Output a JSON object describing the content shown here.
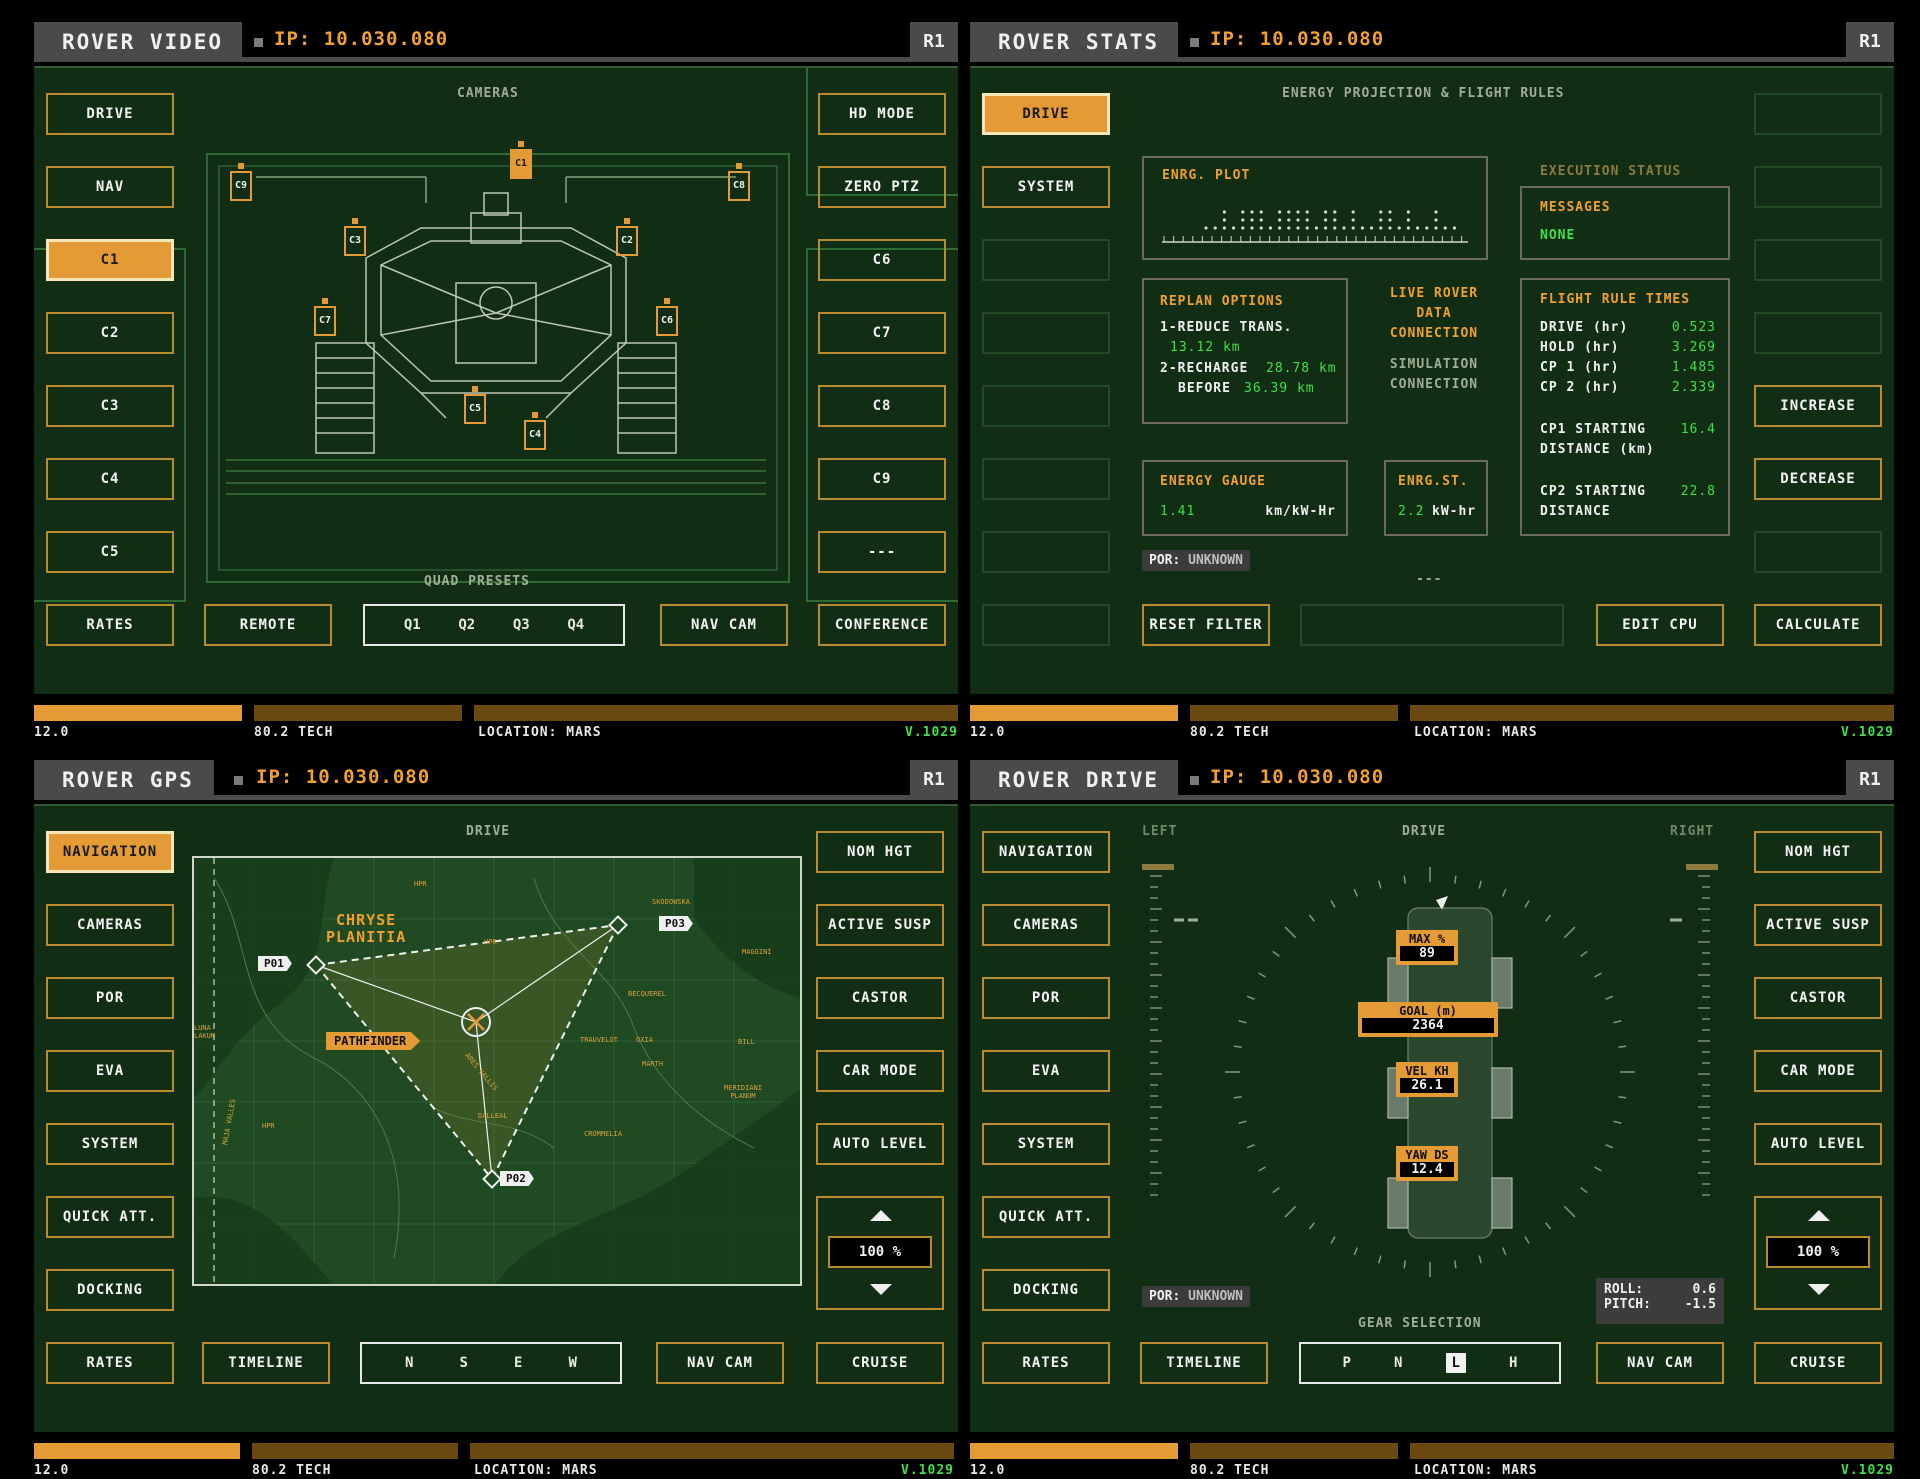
{
  "header": {
    "ip": "IP: 10.030.080",
    "rank": "R1"
  },
  "footer": {
    "value": "12.0",
    "tech": "80.2 TECH",
    "location": "LOCATION: MARS",
    "version": "V.1029"
  },
  "video": {
    "title": "ROVER VIDEO",
    "cameras_label": "CAMERAS",
    "quad_label": "QUAD PRESETS",
    "left": [
      "DRIVE",
      "NAV",
      "C1",
      "C2",
      "C3",
      "C4",
      "C5"
    ],
    "right": [
      "HD MODE",
      "ZERO PTZ",
      "C6",
      "C7",
      "C8",
      "C9",
      "---"
    ],
    "bottom": {
      "rates": "RATES",
      "remote": "REMOTE",
      "quads": [
        "Q1",
        "Q2",
        "Q3",
        "Q4"
      ],
      "navcam": "NAV CAM",
      "conference": "CONFERENCE"
    },
    "tags": [
      "C1",
      "C2",
      "C3",
      "C4",
      "C5",
      "C6",
      "C7",
      "C8",
      "C9"
    ]
  },
  "stats": {
    "title": "ROVER STATS",
    "left": [
      "DRIVE",
      "SYSTEM"
    ],
    "heading": "ENERGY PROJECTION & FLIGHT RULES",
    "plot_label": "ENRG. PLOT",
    "exec_label": "EXECUTION STATUS",
    "messages_label": "MESSAGES",
    "messages_value": "NONE",
    "replan": {
      "title": "REPLAN OPTIONS",
      "l1": "1-REDUCE TRANS.",
      "v1": "13.12 km",
      "l2": "2-RECHARGE",
      "v2": "28.78 km",
      "l3": "BEFORE",
      "v3": "36.39 km"
    },
    "live": {
      "a": "LIVE ROVER",
      "b": "DATA",
      "c": "CONNECTION",
      "d": "SIMULATION",
      "e": "CONNECTION"
    },
    "flight": {
      "title": "FLIGHT RULE TIMES",
      "rows": [
        {
          "k": "DRIVE (hr)",
          "v": "0.523"
        },
        {
          "k": "HOLD (hr)",
          "v": "3.269"
        },
        {
          "k": "CP 1 (hr)",
          "v": "1.485"
        },
        {
          "k": "CP 2 (hr)",
          "v": "2.339"
        }
      ],
      "cp1a": "CP1 STARTING",
      "cp1b": "DISTANCE (km)",
      "cp1v": "16.4",
      "cp2a": "CP2 STARTING",
      "cp2b": "DISTANCE",
      "cp2v": "22.8"
    },
    "gauge": {
      "title": "ENERGY GAUGE",
      "value": "1.41",
      "unit": "km/kW-Hr"
    },
    "enrg": {
      "title": "ENRG.ST.",
      "value": "2.2",
      "unit": "kW-hr"
    },
    "por": "POR:",
    "por_value": "UNKNOWN",
    "dash": "---",
    "right": [
      "INCREASE",
      "DECREASE"
    ],
    "bottom": {
      "reset": "RESET FILTER",
      "edit": "EDIT CPU",
      "calc": "CALCULATE"
    }
  },
  "gps": {
    "title": "ROVER GPS",
    "drive_label": "DRIVE",
    "left": [
      "NAVIGATION",
      "CAMERAS",
      "POR",
      "EVA",
      "SYSTEM",
      "QUICK ATT.",
      "DOCKING"
    ],
    "right": [
      "NOM HGT",
      "ACTIVE SUSP",
      "CASTOR",
      "CAR MODE",
      "AUTO LEVEL"
    ],
    "zoom": "100 %",
    "bottom": {
      "rates": "RATES",
      "timeline": "TIMELINE",
      "dirs": [
        "N",
        "S",
        "E",
        "W"
      ],
      "navcam": "NAV CAM",
      "cruise": "CRUISE"
    },
    "map": {
      "region1": "CHRYSE",
      "region2": "PLANITIA",
      "p01": "P01",
      "p02": "P02",
      "p03": "P03",
      "pathfinder": "PATHFINDER",
      "small": [
        "HPR",
        "HPR",
        "SKODOWSKA",
        "MAGGINI",
        "BECQUEREL",
        "TRAUVELOT",
        "OXIA",
        "BILL",
        "MARTH",
        "MERIDIANI PLANUM",
        "LUNA LAKUM",
        "CROMMELIA",
        "DALLEAL",
        "ARES VALLIS",
        "MAJA VALLES",
        "HPR"
      ]
    }
  },
  "drive": {
    "title": "ROVER DRIVE",
    "drive_label": "DRIVE",
    "left_label": "LEFT",
    "right_label": "RIGHT",
    "left": [
      "NAVIGATION",
      "CAMERAS",
      "POR",
      "EVA",
      "SYSTEM",
      "QUICK ATT.",
      "DOCKING"
    ],
    "right": [
      "NOM HGT",
      "ACTIVE SUSP",
      "CASTOR",
      "CAR MODE",
      "AUTO LEVEL"
    ],
    "zoom": "100 %",
    "readouts": [
      {
        "k": "MAX %",
        "v": "89"
      },
      {
        "k": "GOAL (m)",
        "v": "2364"
      },
      {
        "k": "VEL KH",
        "v": "26.1"
      },
      {
        "k": "YAW DS",
        "v": "12.4"
      }
    ],
    "por": "POR:",
    "por_value": "UNKNOWN",
    "roll_label": "ROLL:",
    "roll": "0.6",
    "pitch_label": "PITCH:",
    "pitch": "-1.5",
    "gear_label": "GEAR SELECTION",
    "gears": [
      "P",
      "N",
      "L",
      "H"
    ],
    "bottom": {
      "rates": "RATES",
      "timeline": "TIMELINE",
      "navcam": "NAV CAM",
      "cruise": "CRUISE"
    }
  }
}
